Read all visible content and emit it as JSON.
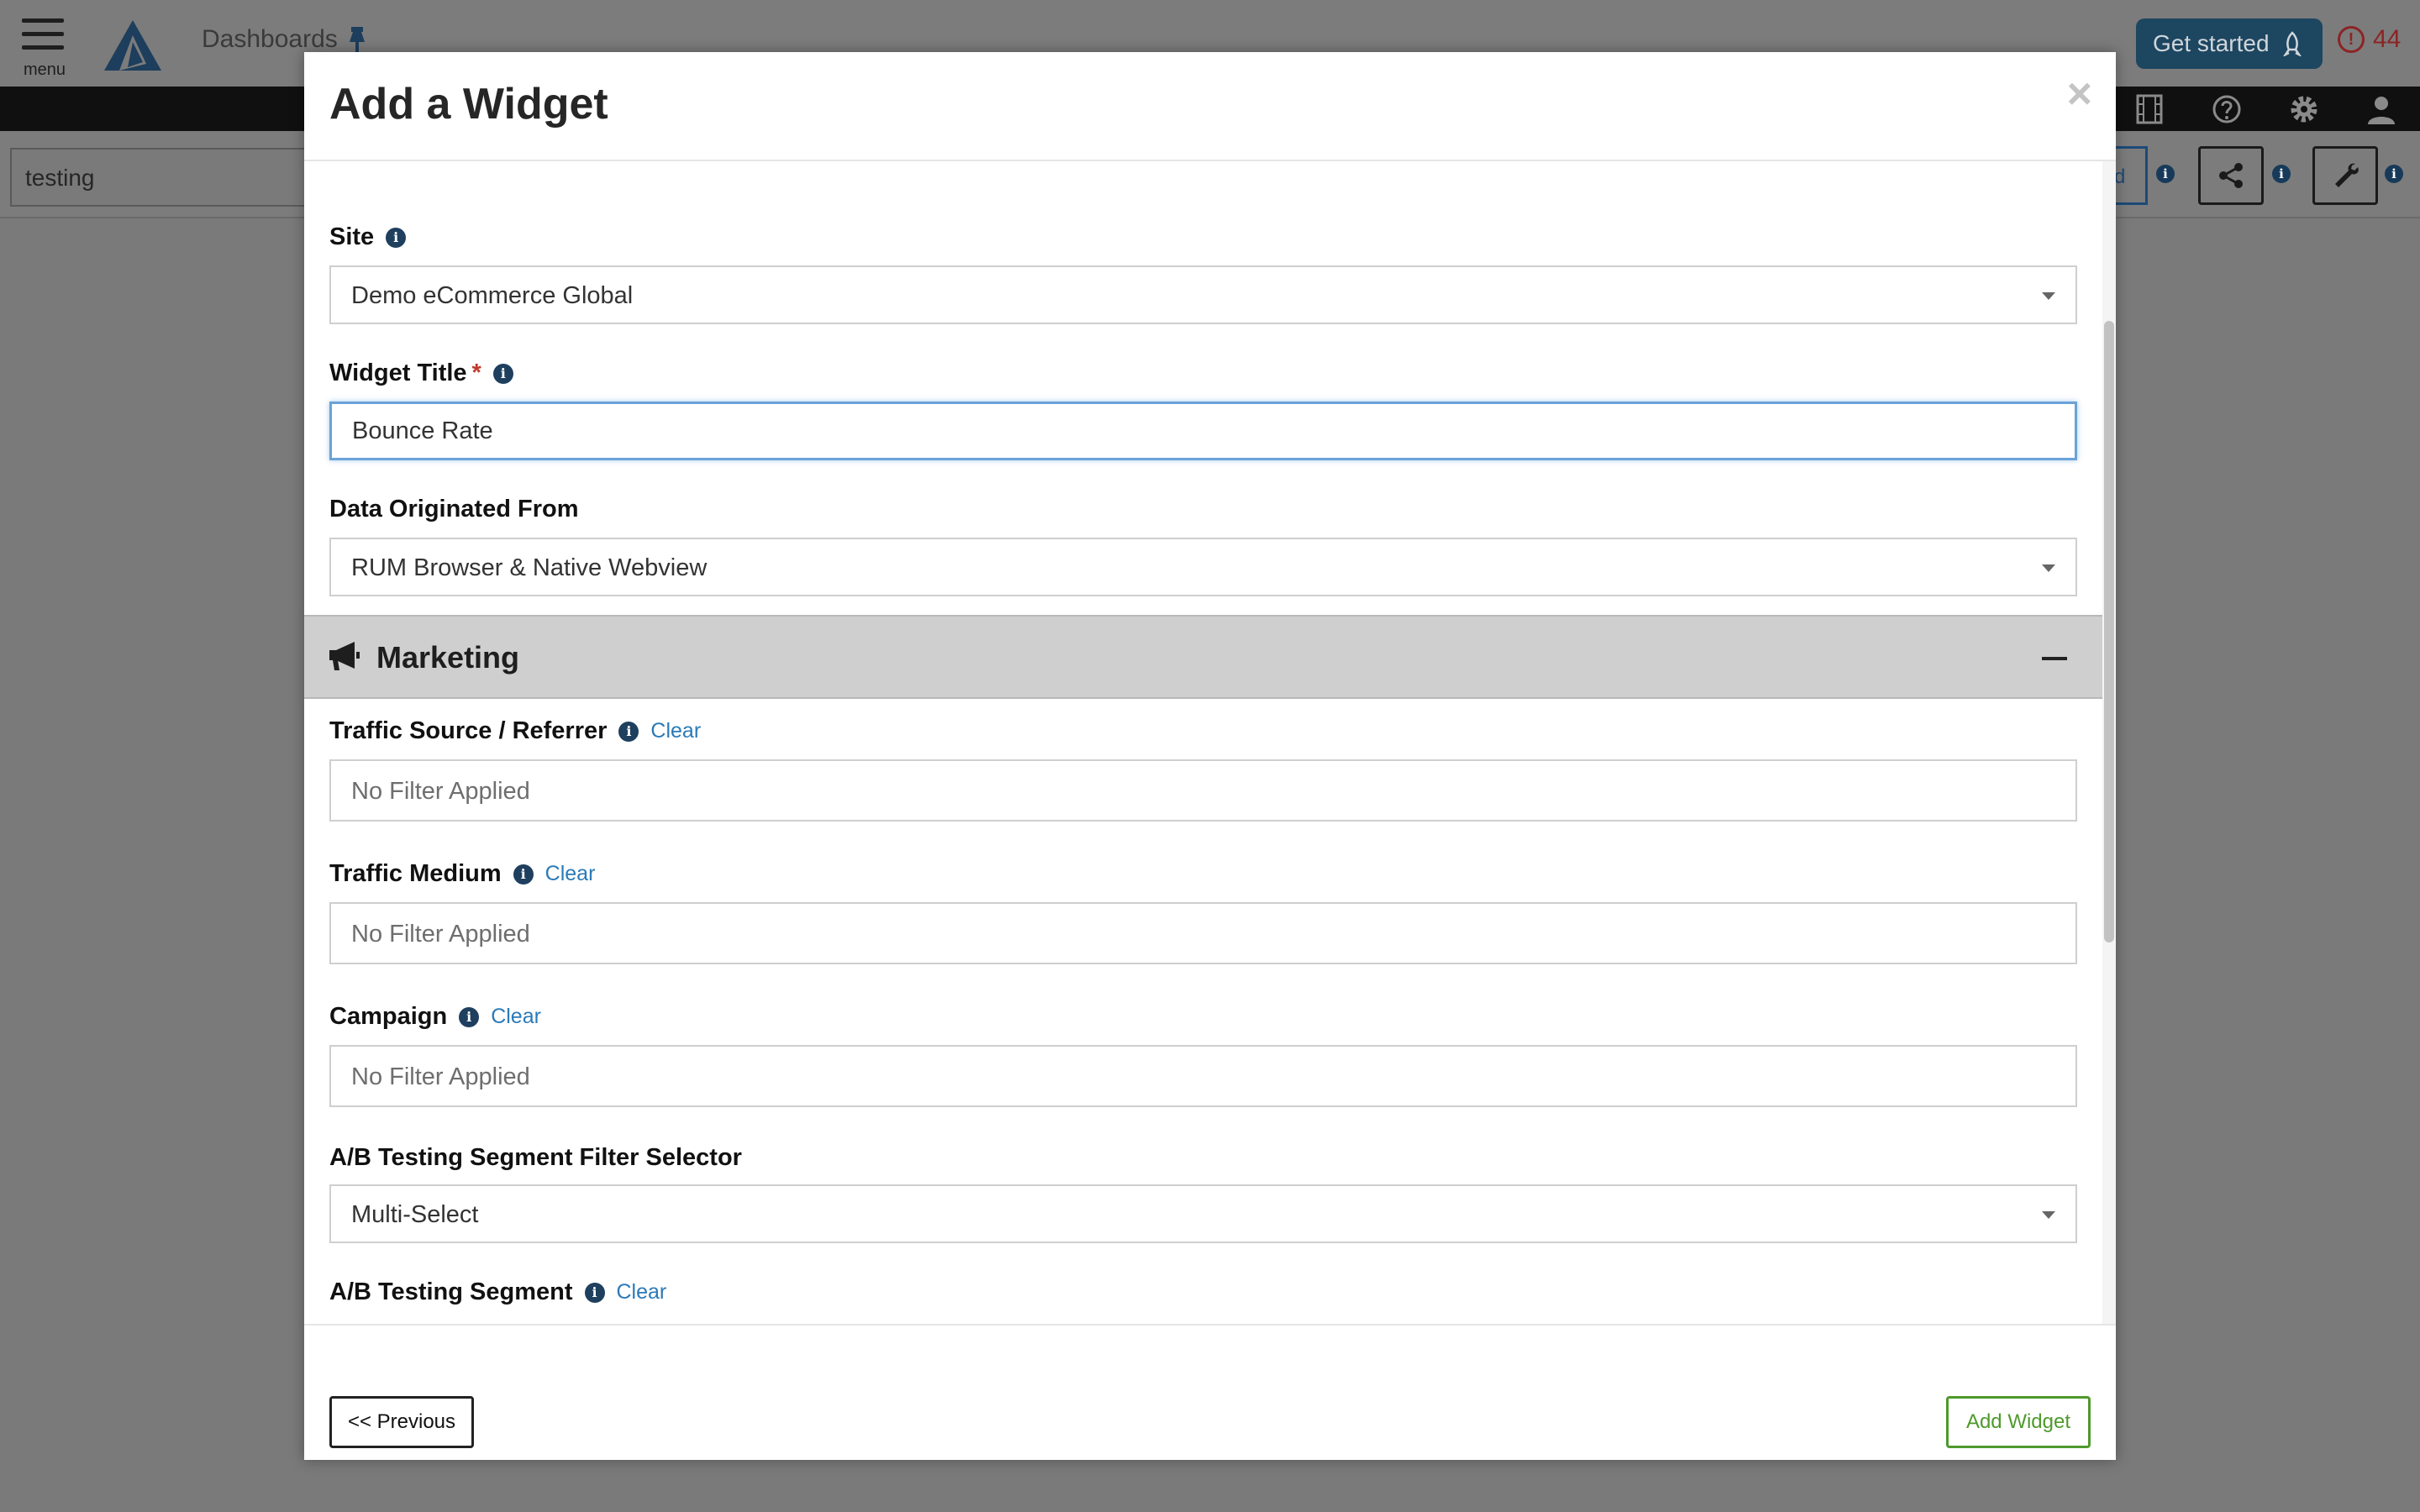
{
  "background": {
    "menu_label": "menu",
    "dashboards_label": "Dashboards",
    "get_started_label": "Get started",
    "alert_count": "44",
    "dashboard_name": "testing",
    "partial_button_text": "d",
    "icons": [
      "hamburger-icon",
      "logo-icon",
      "pin-icon",
      "rocket-icon",
      "alert-icon",
      "film-icon",
      "help-icon",
      "gear-icon",
      "user-icon",
      "share-icon",
      "wrench-icon"
    ]
  },
  "modal": {
    "title": "Add a Widget",
    "close_symbol": "×",
    "site": {
      "label": "Site",
      "value": "Demo eCommerce Global"
    },
    "widget_title": {
      "label": "Widget Title",
      "required_mark": "*",
      "value": "Bounce Rate"
    },
    "data_origin": {
      "label": "Data Originated From",
      "value": "RUM Browser & Native Webview"
    },
    "marketing": {
      "title": "Marketing",
      "traffic_source": {
        "label": "Traffic Source / Referrer",
        "clear": "Clear",
        "placeholder": "No Filter Applied"
      },
      "traffic_medium": {
        "label": "Traffic Medium",
        "clear": "Clear",
        "placeholder": "No Filter Applied"
      },
      "campaign": {
        "label": "Campaign",
        "clear": "Clear",
        "placeholder": "No Filter Applied"
      },
      "ab_selector": {
        "label": "A/B Testing Segment Filter Selector",
        "value": "Multi-Select"
      },
      "ab_segment": {
        "label": "A/B Testing Segment",
        "clear": "Clear"
      }
    },
    "footer": {
      "previous_label": "<< Previous",
      "add_label": "Add Widget"
    }
  },
  "colors": {
    "overlay": "#7a7a7a",
    "accent_blue": "#2a7ab8",
    "add_green": "#4e9a2c",
    "required_red": "#c0392b",
    "get_started_bg": "#1d4660"
  }
}
